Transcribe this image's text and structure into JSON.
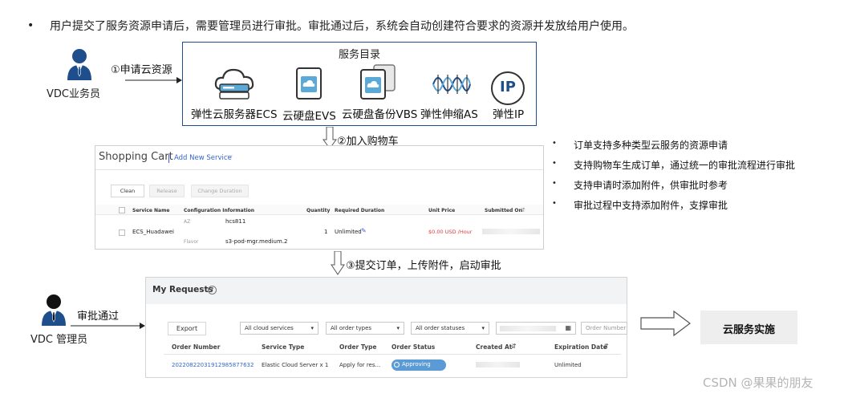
{
  "intro": {
    "bullet": "•",
    "text": "用户提交了服务资源申请后，需要管理员进行审批。审批通过后，系统会自动创建符合要求的资源并发放给用户使用。"
  },
  "actors": {
    "vdc_staff": "VDC业务员",
    "vdc_admin": "VDC 管理员"
  },
  "steps": {
    "step1": "①申请云资源",
    "step2": "②加入购物车",
    "step3": "③提交订单，上传附件，启动审批",
    "approve": "审批通过"
  },
  "catalog": {
    "title": "服务目录",
    "services": [
      {
        "label": "弹性云服务器ECS",
        "icon": "cloud-server-icon"
      },
      {
        "label": "云硬盘EVS",
        "icon": "disk-icon"
      },
      {
        "label": "云硬盘备份VBS",
        "icon": "disk-backup-icon"
      },
      {
        "label": "弹性伸缩AS",
        "icon": "auto-scaling-icon"
      },
      {
        "label": "弹性IP",
        "icon": "ip-icon"
      }
    ],
    "ip_glyph": "IP"
  },
  "cart": {
    "title": "Shopping Cart",
    "add_link": "Add New Service",
    "buttons": {
      "clean": "Clean",
      "release": "Release",
      "change_duration": "Change Duration"
    },
    "columns": [
      "Service Name",
      "Configuration Information",
      "Quantity",
      "Required Duration",
      "Unit Price",
      "Submitted On"
    ],
    "row": {
      "service_name": "ECS_Huadawei",
      "az_label": "AZ",
      "az_value": "hcs811",
      "flavor_label": "Flavor",
      "flavor_value": "s3-pod-mgr.medium.2",
      "quantity": "1",
      "duration": "Unlimited",
      "unit_price": "$0.00 USD /Hour"
    }
  },
  "features": [
    "订单支持多种类型云服务的资源申请",
    "支持购物车生成订单，通过统一的审批流程进行审批",
    "支持申请时添加附件，供审批时参考",
    "审批过程中支持添加附件，支撑审批"
  ],
  "requests": {
    "title": "My Requests",
    "help_glyph": "?",
    "export": "Export",
    "filters": [
      "All cloud services",
      "All order types",
      "All order statuses"
    ],
    "order_number_placeholder": "Order Number",
    "columns": [
      "Order Number",
      "Service Type",
      "Order Type",
      "Order Status",
      "Created At",
      "Expiration Date"
    ],
    "row": {
      "order_number": "20220822031912985877632",
      "service_type": "Elastic Cloud Server x 1",
      "order_type": "Apply for res...",
      "status": "Approving",
      "expiration": "Unlimited"
    }
  },
  "implement": "云服务实施",
  "watermark": "CSDN @果果的朋友",
  "colors": {
    "brand_blue": "#1f4e8c",
    "link_blue": "#3366cc",
    "price_red": "#e03c3c",
    "status_blue": "#5b9bd5"
  }
}
